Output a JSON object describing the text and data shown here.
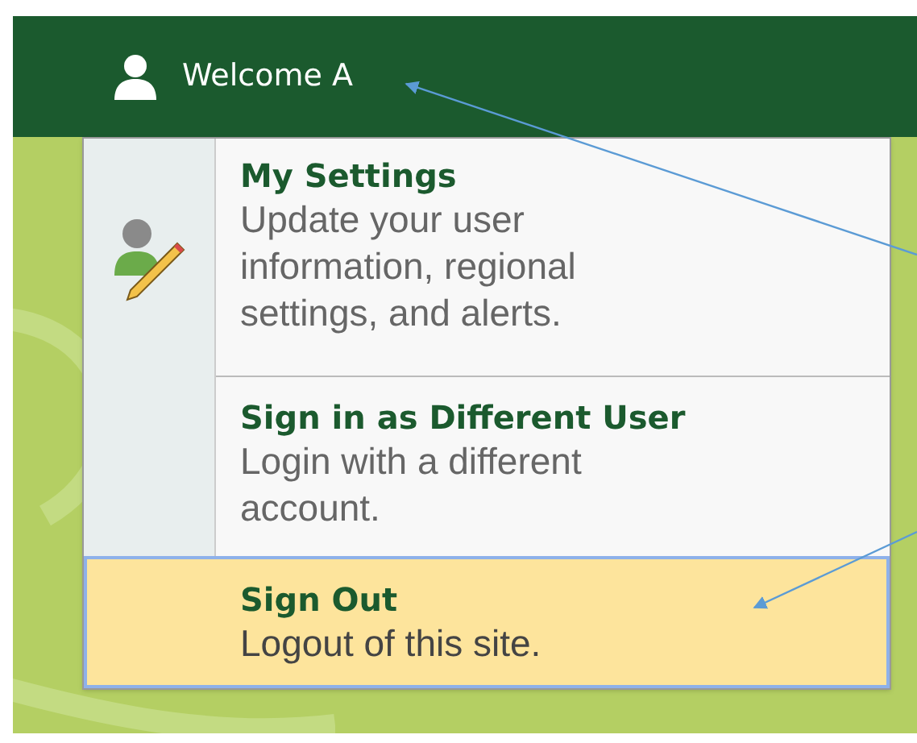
{
  "header": {
    "welcome": "Welcome A"
  },
  "menu_items": [
    {
      "title": "My Settings",
      "description": "Update your user information, regional settings, and alerts.",
      "selected": false
    },
    {
      "title": "Sign in as Different User",
      "description": "Login with a different account.",
      "selected": false
    },
    {
      "title": "Sign Out",
      "description": "Logout of this site.",
      "selected": true
    }
  ]
}
